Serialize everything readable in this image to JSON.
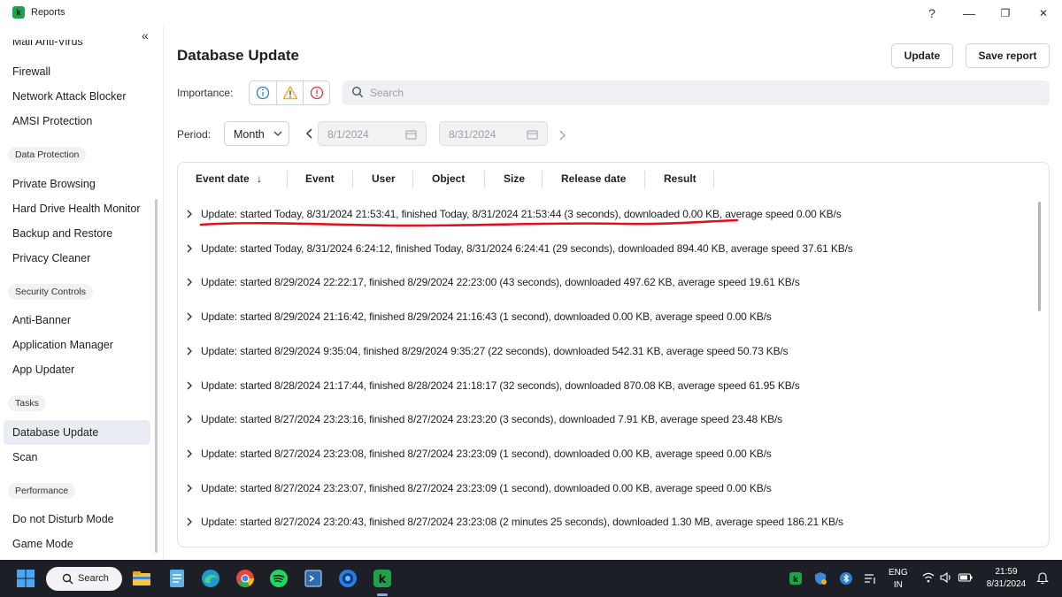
{
  "window": {
    "title": "Reports",
    "help": "?",
    "minimize": "—",
    "maximize": "❐",
    "close": "✕"
  },
  "sidebar": {
    "collapse": "«",
    "items": [
      {
        "type": "item",
        "label": "Mail Anti-Virus"
      },
      {
        "type": "item",
        "label": "Firewall"
      },
      {
        "type": "item",
        "label": "Network Attack Blocker"
      },
      {
        "type": "item",
        "label": "AMSI Protection"
      },
      {
        "type": "group",
        "label": "Data Protection"
      },
      {
        "type": "item",
        "label": "Private Browsing"
      },
      {
        "type": "item",
        "label": "Hard Drive Health Monitor"
      },
      {
        "type": "item",
        "label": "Backup and Restore"
      },
      {
        "type": "item",
        "label": "Privacy Cleaner"
      },
      {
        "type": "group",
        "label": "Security Controls"
      },
      {
        "type": "item",
        "label": "Anti-Banner"
      },
      {
        "type": "item",
        "label": "Application Manager"
      },
      {
        "type": "item",
        "label": "App Updater"
      },
      {
        "type": "group",
        "label": "Tasks"
      },
      {
        "type": "item",
        "label": "Database Update",
        "active": true
      },
      {
        "type": "item",
        "label": "Scan"
      },
      {
        "type": "group",
        "label": "Performance"
      },
      {
        "type": "item",
        "label": "Do not Disturb Mode"
      },
      {
        "type": "item",
        "label": "Game Mode"
      }
    ]
  },
  "main": {
    "title": "Database Update",
    "update_button": "Update",
    "save_report_button": "Save report",
    "importance_label": "Importance:",
    "search_placeholder": "Search",
    "period_label": "Period:",
    "period_value": "Month",
    "date_from": "8/1/2024",
    "date_to": "8/31/2024"
  },
  "table": {
    "columns": [
      "Event date",
      "Event",
      "User",
      "Object",
      "Size",
      "Release date",
      "Result"
    ],
    "sort_indicator": "↓",
    "rows": [
      "Update: started Today, 8/31/2024 21:53:41, finished Today, 8/31/2024 21:53:44 (3 seconds), downloaded 0.00 KB, average speed 0.00 KB/s",
      "Update: started Today, 8/31/2024 6:24:12, finished Today, 8/31/2024 6:24:41 (29 seconds), downloaded 894.40 KB, average speed 37.61 KB/s",
      "Update: started 8/29/2024 22:22:17, finished 8/29/2024 22:23:00 (43 seconds), downloaded 497.62 KB, average speed 19.61 KB/s",
      "Update: started 8/29/2024 21:16:42, finished 8/29/2024 21:16:43 (1 second), downloaded 0.00 KB, average speed 0.00 KB/s",
      "Update: started 8/29/2024 9:35:04, finished 8/29/2024 9:35:27 (22 seconds), downloaded 542.31 KB, average speed 50.73 KB/s",
      "Update: started 8/28/2024 21:17:44, finished 8/28/2024 21:18:17 (32 seconds), downloaded 870.08 KB, average speed 61.95 KB/s",
      "Update: started 8/27/2024 23:23:16, finished 8/27/2024 23:23:20 (3 seconds), downloaded 7.91 KB, average speed 23.48 KB/s",
      "Update: started 8/27/2024 23:23:08, finished 8/27/2024 23:23:09 (1 second), downloaded 0.00 KB, average speed 0.00 KB/s",
      "Update: started 8/27/2024 23:23:07, finished 8/27/2024 23:23:09 (1 second), downloaded 0.00 KB, average speed 0.00 KB/s",
      "Update: started 8/27/2024 23:20:43, finished 8/27/2024 23:23:08 (2 minutes 25 seconds), downloaded 1.30 MB, average speed 186.21 KB/s"
    ]
  },
  "taskbar": {
    "search_label": "Search",
    "language": "ENG",
    "region": "IN",
    "time": "21:59",
    "date": "8/31/2024"
  },
  "colors": {
    "accent_green": "#1fa34a",
    "annotation_red": "#e3101a",
    "info_blue": "#2f80d1",
    "warning_yellow": "#f2b01e",
    "critical_red": "#d83b3b"
  }
}
